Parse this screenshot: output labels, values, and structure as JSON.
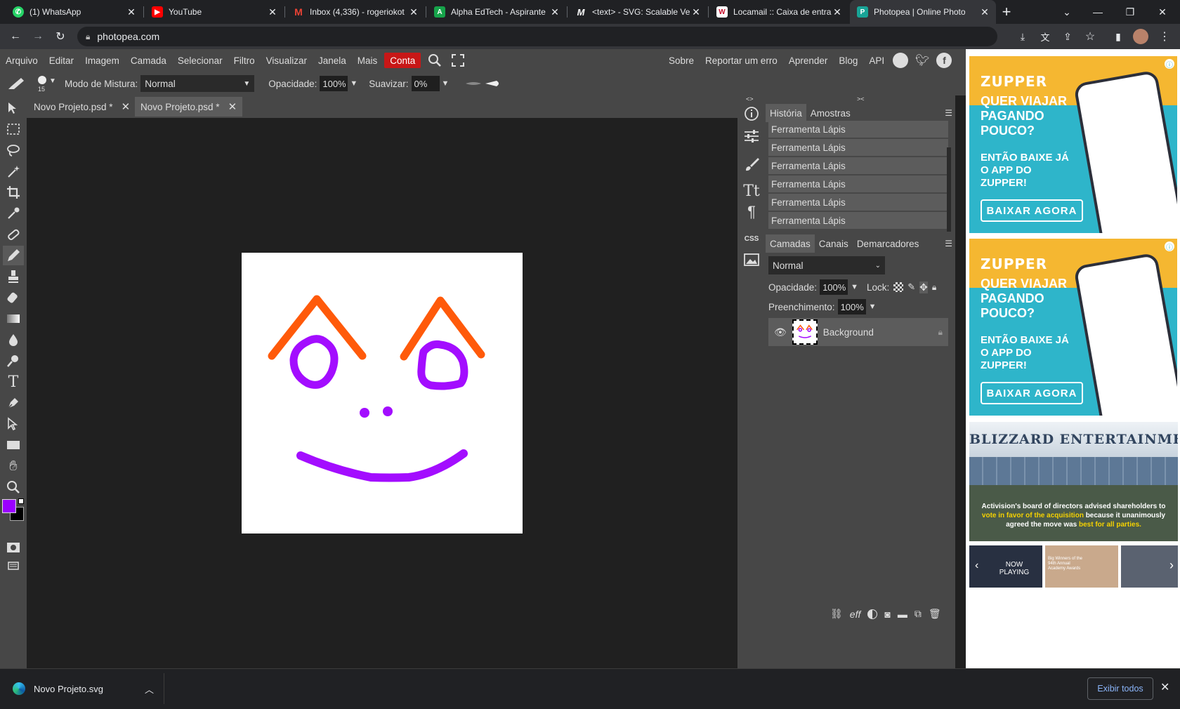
{
  "browser": {
    "tabs": [
      {
        "title": "(1) WhatsApp",
        "icon": "whatsapp-icon",
        "color": "#25d366"
      },
      {
        "title": "YouTube",
        "icon": "youtube-icon",
        "color": "#ff0000"
      },
      {
        "title": "Inbox (4,336) - rogeriokot",
        "icon": "gmail-icon",
        "color": "#ea4335"
      },
      {
        "title": "Alpha EdTech - Aspirante",
        "icon": "alpha-edtech-icon",
        "color": "#16a34a"
      },
      {
        "title": "<text> - SVG: Scalable Ve",
        "icon": "mdn-icon",
        "color": "#ffffff"
      },
      {
        "title": "Locamail :: Caixa de entra",
        "icon": "locamail-icon",
        "color": "#c8102e"
      },
      {
        "title": "Photopea | Online Photo",
        "icon": "photopea-icon",
        "color": "#18a497",
        "active": true
      }
    ],
    "url": "photopea.com"
  },
  "menu": {
    "items": [
      "Arquivo",
      "Editar",
      "Imagem",
      "Camada",
      "Selecionar",
      "Filtro",
      "Visualizar",
      "Janela",
      "Mais"
    ],
    "account": "Conta",
    "right_items": [
      "Sobre",
      "Reportar um erro",
      "Aprender",
      "Blog",
      "API"
    ]
  },
  "options": {
    "brush_size": "15",
    "blend_label": "Modo de Mistura:",
    "blend_value": "Normal",
    "opacity_label": "Opacidade:",
    "opacity_value": "100%",
    "smooth_label": "Suavizar:",
    "smooth_value": "0%"
  },
  "documents": {
    "tabs": [
      "Novo Projeto.psd *",
      "Novo Projeto.psd *"
    ],
    "active_index": 1
  },
  "colors": {
    "foreground": "#9b00ff",
    "background": "#000000",
    "orange_stroke": "#ff5a0a",
    "purple_stroke": "#a30dff"
  },
  "history_panel": {
    "tabs": [
      "História",
      "Amostras"
    ],
    "items": [
      "Ferramenta Lápis",
      "Ferramenta Lápis",
      "Ferramenta Lápis",
      "Ferramenta Lápis",
      "Ferramenta Lápis",
      "Ferramenta Lápis"
    ]
  },
  "layers_panel": {
    "tabs": [
      "Camadas",
      "Canais",
      "Demarcadores"
    ],
    "blend_mode": "Normal",
    "opacity_label": "Opacidade:",
    "opacity_value": "100%",
    "lock_label": "Lock:",
    "fill_label": "Preenchimento:",
    "fill_value": "100%",
    "layers": [
      {
        "name": "Background",
        "locked": true,
        "visible": true
      }
    ],
    "footer_eff": "eff"
  },
  "ads": {
    "zupper": {
      "logo": "ZUPPER",
      "headline": "QUER VIAJAR PAGANDO POUCO?",
      "sub": "ENTÃO BAIXE JÁ O APP DO ZUPPER!",
      "button": "BAIXAR AGORA"
    },
    "video": {
      "building_sign": "BLIZZARD ENTERTAINMENT",
      "caption_pre": "Activision's board of directors advised shareholders to ",
      "caption_hl1": "vote in favor of the acquisition",
      "caption_mid": " because it unanimously agreed the move was ",
      "caption_hl2": "best for all parties.",
      "now_playing": "NOW PLAYING",
      "thumb2_title": "Big Winners of the 94th Annual Academy Awards"
    }
  },
  "downloads": {
    "file": "Novo Projeto.svg",
    "show_all": "Exibir todos"
  }
}
